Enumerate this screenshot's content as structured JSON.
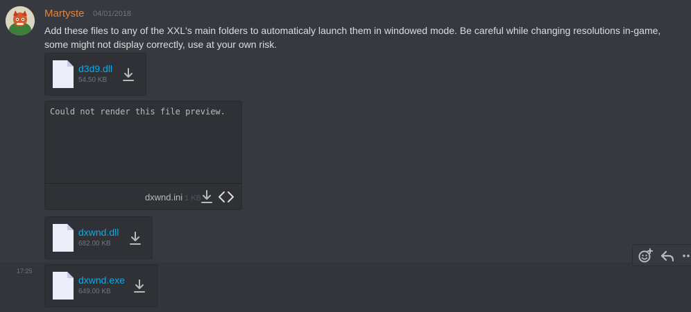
{
  "message": {
    "author": "Martyste",
    "timestamp": "04/01/2018",
    "text": "Add these files to any of the XXL's main folders to automaticaly launch them in windowed mode. Be careful while changing resolutions in-game, some might not display correctly, use at your own risk."
  },
  "attachments": [
    {
      "name": "d3d9.dll",
      "size": "54.50 KB",
      "icon": "file-icon",
      "download_icon": "download-icon"
    },
    {
      "name": "dxwnd.dll",
      "size": "682.00 KB",
      "icon": "file-icon",
      "download_icon": "download-icon"
    }
  ],
  "preview": {
    "body_text": "Could not render this file preview.",
    "file_name": "dxwnd.ini",
    "file_size": "1 KB",
    "download_icon": "download-icon",
    "expand_icon": "code-expand-icon"
  },
  "followup": {
    "side_time": "17:25",
    "attachment": {
      "name": "dxwnd.exe",
      "size": "649.00 KB",
      "icon": "file-icon",
      "download_icon": "download-icon"
    }
  },
  "hover_actions": {
    "icons": [
      "add-reaction-icon",
      "reply-icon",
      "more-options-icon"
    ]
  },
  "colors": {
    "background": "#36393f",
    "author": "#e6833a",
    "link": "#00b0f4",
    "attachment_bg": "#2f3136",
    "muted": "#72767d"
  }
}
